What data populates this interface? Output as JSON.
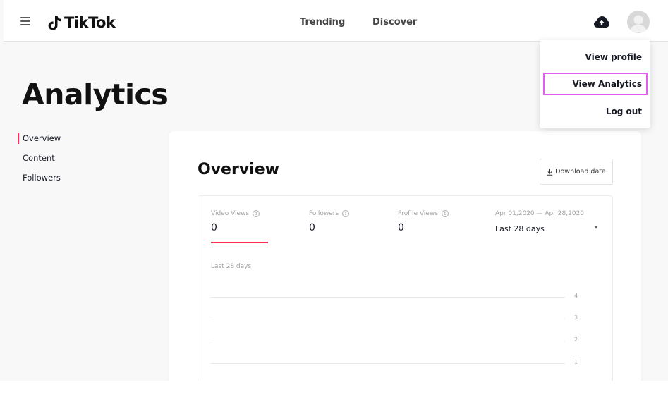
{
  "header": {
    "logo_text": "TikTok",
    "nav": [
      "Trending",
      "Discover"
    ],
    "icons": [
      "hamburger-menu-icon",
      "tiktok-note-icon",
      "cloud-upload-icon",
      "avatar"
    ]
  },
  "page": {
    "title": "Analytics"
  },
  "sidebar": {
    "items": [
      {
        "label": "Overview",
        "active": true
      },
      {
        "label": "Content",
        "active": false
      },
      {
        "label": "Followers",
        "active": false
      }
    ]
  },
  "overview": {
    "title": "Overview",
    "download_label": "Download data",
    "metrics": [
      {
        "label": "Video Views",
        "value": "0",
        "selected": true
      },
      {
        "label": "Followers",
        "value": "0",
        "selected": false
      },
      {
        "label": "Profile Views",
        "value": "0",
        "selected": false
      }
    ],
    "date_range": "Apr 01,2020 — Apr 28,2020",
    "period": "Last 28 days",
    "chart_label": "Last 28 days",
    "y_ticks": [
      "4",
      "3",
      "2",
      "1"
    ]
  },
  "menu": {
    "items": [
      "View profile",
      "View Analytics",
      "Log out"
    ],
    "highlighted": "View Analytics"
  },
  "colors": {
    "accent": "#fe2c55",
    "highlight_border": "#e45df0",
    "background": "#f8f8f8"
  }
}
